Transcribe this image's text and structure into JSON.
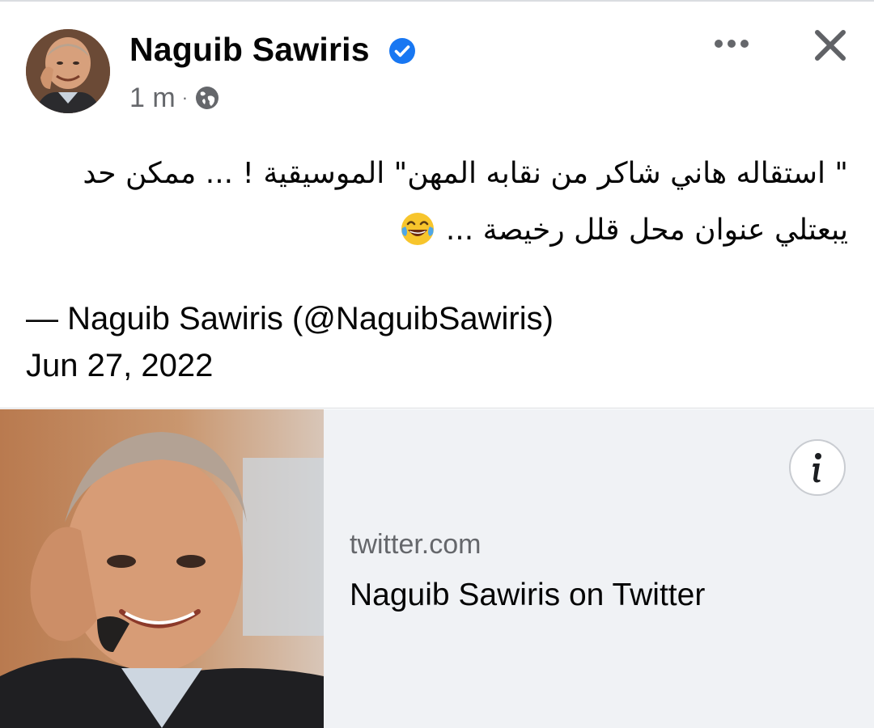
{
  "post": {
    "author": "Naguib Sawiris",
    "time": "1 m",
    "separator": "·",
    "audience_icon": "globe-icon",
    "verified_icon": "verified-badge-icon",
    "text_line_1": "\" استقاله هاني شاكر من نقابه المهن\" الموسيقية ! ... ممكن حد",
    "text_line_2": "يبعتلي عنوان محل قلل رخيصة ...",
    "text_emoji": "face-with-tears-of-joy-icon",
    "quote_attribution": "— Naguib Sawiris (@NaguibSawiris)",
    "quote_date": "Jun 27, 2022"
  },
  "header_actions": {
    "more_icon": "more-options-icon",
    "close_icon": "close-icon"
  },
  "link_preview": {
    "domain": "twitter.com",
    "title": "Naguib Sawiris on Twitter",
    "info_icon": "info-icon"
  },
  "colors": {
    "verified_blue": "#1877f2",
    "secondary_text": "#65676b",
    "card_background": "#f0f2f5",
    "primary_text": "#050505"
  }
}
